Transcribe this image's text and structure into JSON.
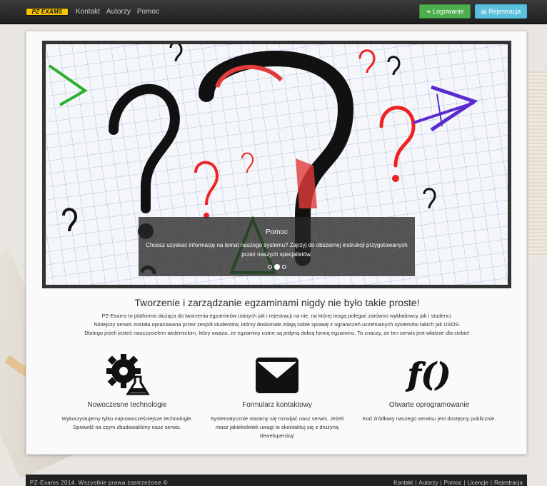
{
  "navbar": {
    "brand": "PZ EXAMS",
    "links": [
      "Kontakt",
      "Autorzy",
      "Pomoc"
    ],
    "login_label": "Logowanie",
    "register_label": "Rejestracja"
  },
  "carousel": {
    "caption_title": "Pomoc",
    "caption_text": "Chcesz uzyskać informację na temat naszego systemu? Zajrzyj do obszernej instrukcji przygotowanych przez naszych specjalistów.",
    "slides": 3,
    "active_slide": 2
  },
  "main": {
    "headline": "Tworzenie i zarządzanie egzaminami nigdy nie było takie proste!",
    "intro_lines": [
      "PZ-Exams to platforma służąca do tworzenia egzaminów ustnych jak i rejestracji na nie, na której mogą polegać zarówno wykładowcy jak i studenci.",
      "Niniejszy serwis została opracowana przez zespół studentów, którzy doskonale zdają sobie sprawę z ograniczeń uczelnianych systemów takich jak USOS.",
      "Dlatego jeżeli jesteś nauczycielem akdemickim, który uważa, że egzaminy ustne są jedyną dobrą formą egzaminu. To znaczy, że ten serwis jest właśnie dla ciebie!"
    ]
  },
  "features": [
    {
      "icon": "gear-flask-icon",
      "title": "Nowoczesne technologie",
      "text": "Wykorzystujemy tylko najnowocześniejsze technologie. Sprawdź na czym zbudowaliśmy nasz serwis."
    },
    {
      "icon": "envelope-icon",
      "title": "Formularz kontaktowy",
      "text": "Systematycznie staramy się rozwijać nasz serwis. Jeżeli masz jakiekolwiek uwagi to skontaktuj się z drużyną deweloperską!"
    },
    {
      "icon": "function-icon",
      "icon_text": "f()",
      "title": "Otwarte oprogramowanie",
      "text": "Kod źródłowy naszego serwisu jest dostępny publicznie."
    }
  ],
  "footer": {
    "copyright": "PZ-Exams 2014. Wszystkie prawa zastrzeżone ©",
    "links": [
      "Kontakt",
      "Autorzy",
      "Pomoc",
      "Licencje",
      "Rejestracja"
    ]
  },
  "colors": {
    "login": "#4cae4c",
    "register": "#5bc0de",
    "brand": "#f5c400",
    "navbar": "#2b2b2b"
  }
}
